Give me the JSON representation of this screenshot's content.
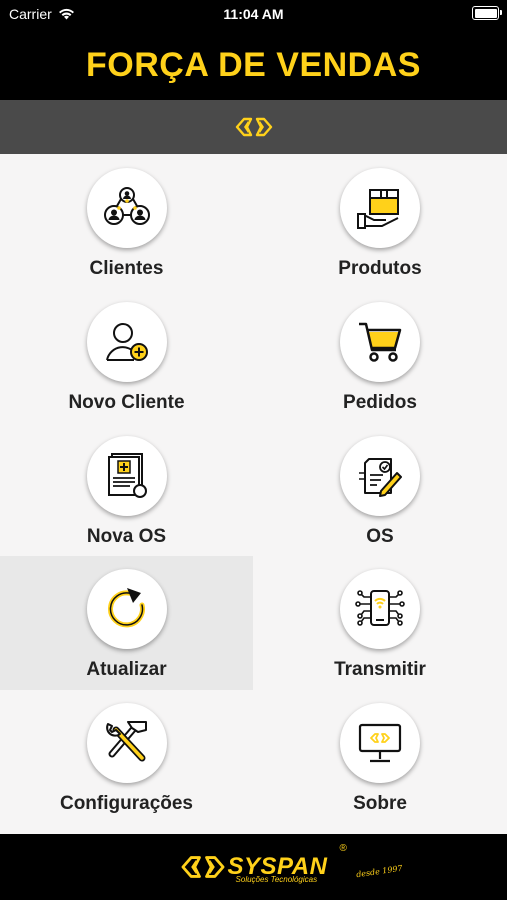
{
  "status_bar": {
    "carrier": "Carrier",
    "time": "11:04 AM"
  },
  "header": {
    "title": "FORÇA DE VENDAS"
  },
  "menu": [
    {
      "label": "Clientes",
      "icon": "clients-group-icon"
    },
    {
      "label": "Produtos",
      "icon": "product-box-hand-icon"
    },
    {
      "label": "Novo Cliente",
      "icon": "add-user-icon"
    },
    {
      "label": "Pedidos",
      "icon": "shopping-cart-icon"
    },
    {
      "label": "Nova OS",
      "icon": "new-document-icon"
    },
    {
      "label": "OS",
      "icon": "service-order-icon"
    },
    {
      "label": "Atualizar",
      "icon": "refresh-icon"
    },
    {
      "label": "Transmitir",
      "icon": "transmit-phone-icon"
    },
    {
      "label": "Configurações",
      "icon": "tools-icon"
    },
    {
      "label": "Sobre",
      "icon": "monitor-logo-icon"
    }
  ],
  "footer": {
    "brand": "SYSPAN",
    "registered": "®",
    "tagline": "Soluções Tecnológicas",
    "since": "desde 1997"
  },
  "colors": {
    "accent": "#ffd11a",
    "header_bg": "#000000",
    "logo_bar_bg": "#4a4a4a",
    "content_bg": "#f6f5f5",
    "active_tile_bg": "#e8e8e8"
  }
}
